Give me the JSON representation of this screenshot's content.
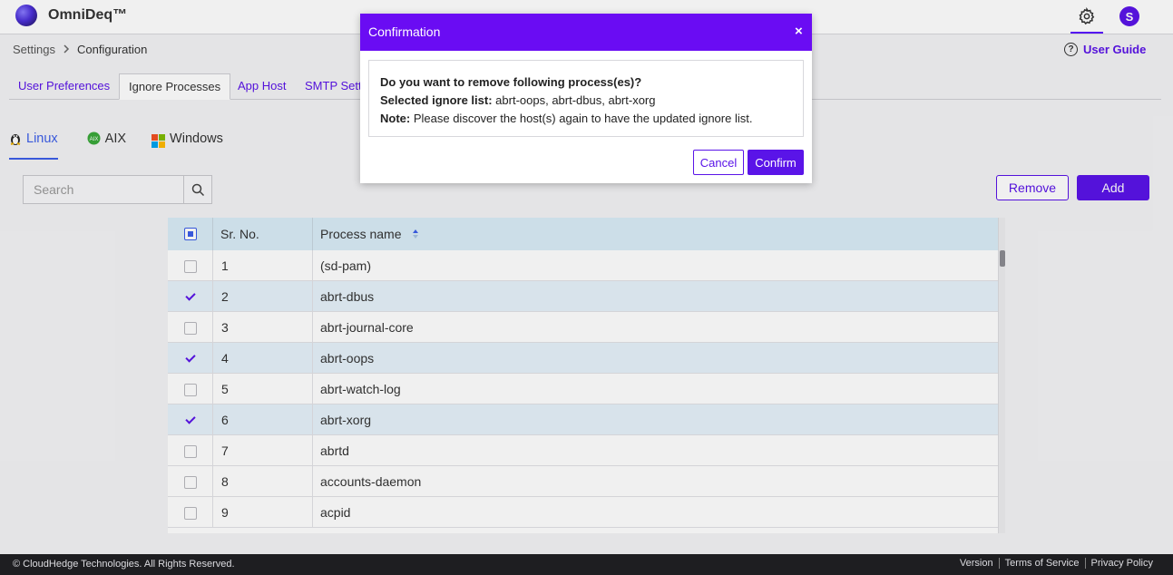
{
  "app": {
    "brand": "OmniDeq™",
    "avatar_initial": "S",
    "accent_color": "#5a14e8",
    "header_icons": [
      "logo-icon",
      "gear-icon"
    ]
  },
  "breadcrumb": {
    "items": [
      "Settings",
      "Configuration"
    ],
    "separator_icon": "chevron-right-icon"
  },
  "user_guide": {
    "label": "User Guide",
    "icon": "question-circle-icon"
  },
  "settings_tabs": [
    {
      "label": "User Preferences",
      "active": false
    },
    {
      "label": "Ignore Processes",
      "active": true
    },
    {
      "label": "App Host",
      "active": false
    },
    {
      "label": "SMTP Sett",
      "active": false
    }
  ],
  "os_tabs": [
    {
      "label": "Linux",
      "icon": "linux-icon",
      "active": true
    },
    {
      "label": "AIX",
      "icon": "aix-icon",
      "active": false
    },
    {
      "label": "Windows",
      "icon": "windows-icon",
      "active": false
    }
  ],
  "search": {
    "placeholder": "Search",
    "value": "",
    "icon": "search-icon"
  },
  "actions": {
    "remove_label": "Remove",
    "add_label": "Add"
  },
  "table": {
    "columns": [
      "Sr. No.",
      "Process name"
    ],
    "sort_icon": "sort-icon",
    "header_select_state": "partial",
    "rows": [
      {
        "sr": "1",
        "name": "(sd-pam)",
        "selected": false
      },
      {
        "sr": "2",
        "name": "abrt-dbus",
        "selected": true
      },
      {
        "sr": "3",
        "name": "abrt-journal-core",
        "selected": false
      },
      {
        "sr": "4",
        "name": "abrt-oops",
        "selected": true
      },
      {
        "sr": "5",
        "name": "abrt-watch-log",
        "selected": false
      },
      {
        "sr": "6",
        "name": "abrt-xorg",
        "selected": true
      },
      {
        "sr": "7",
        "name": "abrtd",
        "selected": false
      },
      {
        "sr": "8",
        "name": "accounts-daemon",
        "selected": false
      },
      {
        "sr": "9",
        "name": "acpid",
        "selected": false
      }
    ]
  },
  "footer": {
    "copyright": "© CloudHedge Technologies. All Rights Reserved.",
    "links": [
      "Version",
      "Terms of Service",
      "Privacy Policy"
    ]
  },
  "modal": {
    "title": "Confirmation",
    "close_label": "×",
    "question": "Do you want to remove following process(es)?",
    "selected_label": "Selected ignore list:",
    "selected_value": "abrt-oops, abrt-dbus, abrt-xorg",
    "note_label": "Note:",
    "note_value": "Please discover the host(s) again to have the updated ignore list.",
    "cancel_label": "Cancel",
    "confirm_label": "Confirm"
  }
}
